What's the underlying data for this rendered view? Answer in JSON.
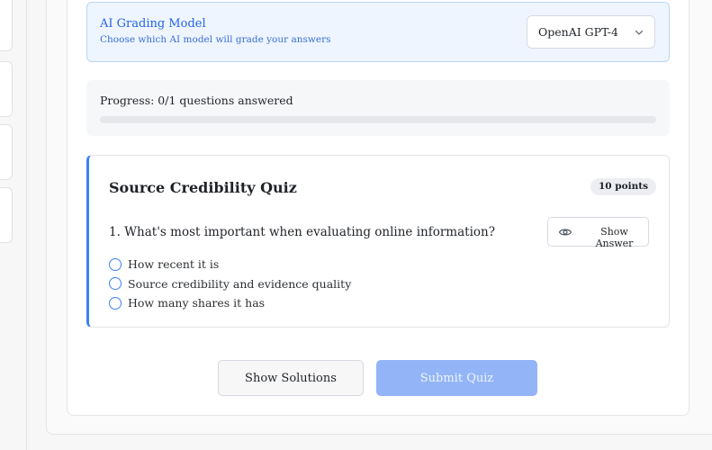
{
  "grading": {
    "title": "AI Grading Model",
    "description": "Choose which AI model will grade your answers",
    "selected_model": "OpenAI GPT-4"
  },
  "progress": {
    "text": "Progress: 0/1 questions answered",
    "fraction": 0
  },
  "quiz": {
    "title": "Source Credibility Quiz",
    "points": "10 points",
    "question": "1. What's most important when evaluating online information?",
    "show_answer_label": "Show Answer",
    "options": [
      "How recent it is",
      "Source credibility and evidence quality",
      "How many shares it has"
    ]
  },
  "actions": {
    "show_solutions": "Show Solutions",
    "submit": "Submit Quiz"
  },
  "colors": {
    "accent": "#3b82f6",
    "submit_disabled": "#93b5f7",
    "model_box_bg": "#eef5fe"
  },
  "icons": {
    "select": "chevron-down-icon",
    "show_answer": "eye-icon"
  }
}
